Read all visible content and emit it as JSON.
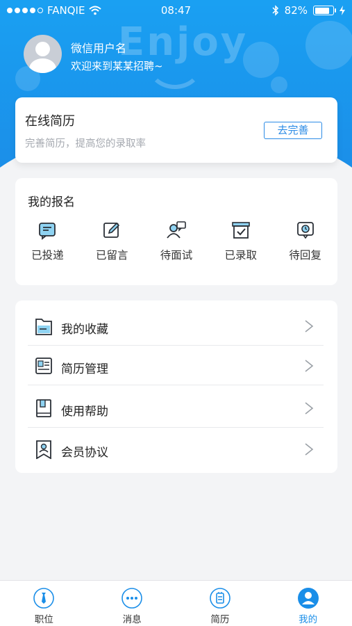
{
  "status_bar": {
    "carrier": "FANQIE",
    "time": "08:47",
    "battery": "82%",
    "battery_level": 0.82
  },
  "header": {
    "username": "微信用户名",
    "welcome": "欢迎来到某某招聘~",
    "decor_text": "Enjoy"
  },
  "resume": {
    "title": "在线简历",
    "subtitle": "完善简历，提高您的录取率",
    "button": "去完善"
  },
  "registration": {
    "title": "我的报名",
    "items": [
      {
        "label": "已投递",
        "icon": "delivered-icon"
      },
      {
        "label": "已留言",
        "icon": "edit-message-icon"
      },
      {
        "label": "待面试",
        "icon": "interview-icon"
      },
      {
        "label": "已录取",
        "icon": "admitted-icon"
      },
      {
        "label": "待回复",
        "icon": "pending-reply-icon"
      }
    ]
  },
  "menu": {
    "items": [
      {
        "label": "我的收藏",
        "icon": "folder-icon"
      },
      {
        "label": "简历管理",
        "icon": "id-card-icon"
      },
      {
        "label": "使用帮助",
        "icon": "book-icon"
      },
      {
        "label": "会员协议",
        "icon": "member-badge-icon"
      }
    ]
  },
  "tabbar": {
    "items": [
      {
        "label": "职位",
        "icon": "tie-icon"
      },
      {
        "label": "消息",
        "icon": "chat-dots-icon"
      },
      {
        "label": "简历",
        "icon": "resume-icon"
      },
      {
        "label": "我的",
        "icon": "user-icon",
        "active": true
      }
    ]
  },
  "colors": {
    "primary": "#1a8ee8",
    "accent_light": "#8fd3f2"
  }
}
